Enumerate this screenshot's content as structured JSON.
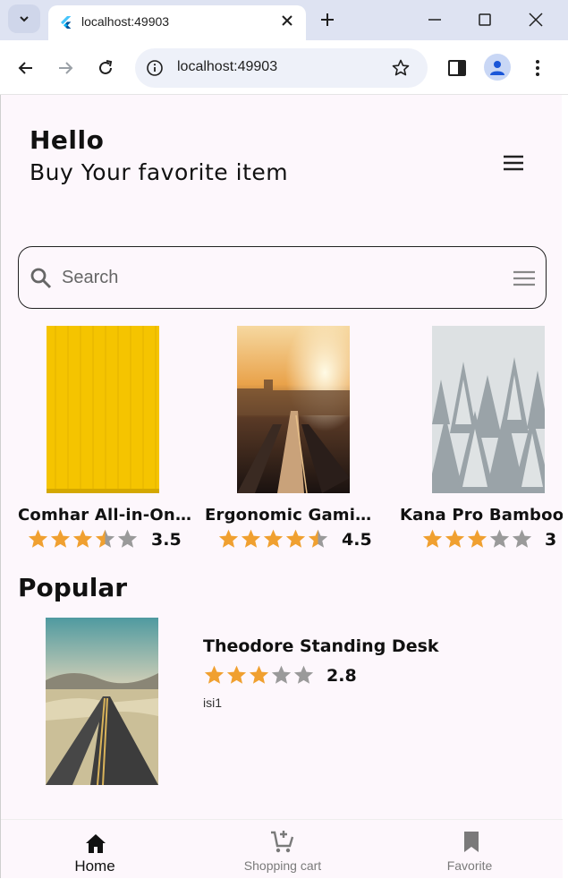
{
  "browser": {
    "tab_title": "localhost:49903",
    "url": "localhost:49903"
  },
  "header": {
    "greeting": "Hello",
    "subtitle": "Buy Your favorite item"
  },
  "search": {
    "placeholder": "Search"
  },
  "products": [
    {
      "title": "Comhar All-in-One Glass Desk",
      "rating": "3.5",
      "stars": 3.5,
      "image": "yellow-texture"
    },
    {
      "title": "Ergonomic Gaming Chair",
      "rating": "4.5",
      "stars": 4.5,
      "image": "sunset-traffic"
    },
    {
      "title": "Kana Pro Bamboo Desk",
      "rating": "3",
      "stars": 3,
      "image": "snowy-forest"
    }
  ],
  "popular": {
    "heading": "Popular",
    "item": {
      "title": "Theodore Standing Desk",
      "rating": "2.8",
      "stars": 3,
      "description": "isi1",
      "image": "desert-road"
    }
  },
  "bottom_nav": [
    {
      "label": "Home",
      "icon": "home-icon",
      "active": true
    },
    {
      "label": "Shopping cart",
      "icon": "add-cart-icon",
      "active": false
    },
    {
      "label": "Favorite",
      "icon": "bookmark-icon",
      "active": false
    }
  ],
  "colors": {
    "star_filled": "#f0a030",
    "star_empty": "#9a9a9a",
    "app_bg": "#fdf7fc",
    "tabstrip_bg": "#dee3f2"
  }
}
